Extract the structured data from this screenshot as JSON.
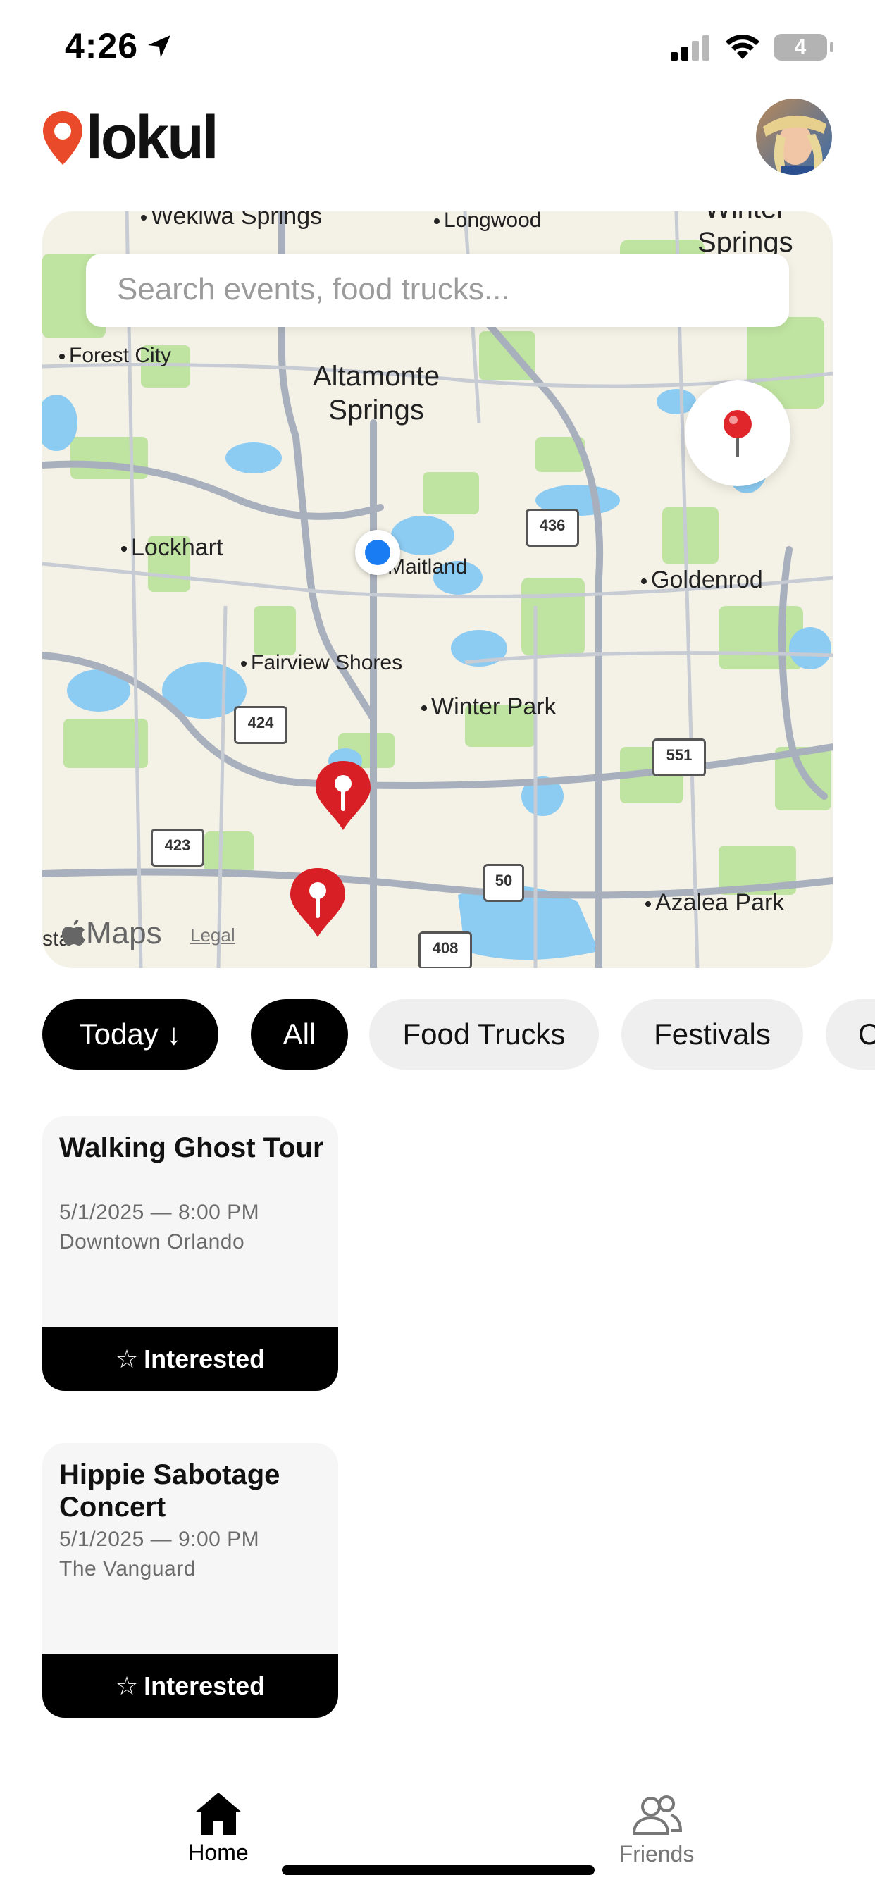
{
  "status_bar": {
    "time": "4:26",
    "battery": "4"
  },
  "header": {
    "logo_text": "lokul",
    "brand_color": "#e84a2a"
  },
  "search": {
    "placeholder": "Search events, food trucks..."
  },
  "map": {
    "labels": {
      "wekiwa": "Wekiwa Springs",
      "longwood": "Longwood",
      "winter_springs_1": "Winter",
      "winter_springs_2": "Springs",
      "forest_city": "Forest City",
      "altamonte_1": "Altamonte",
      "altamonte_2": "Springs",
      "lockhart": "Lockhart",
      "maitland": "Maitland",
      "goldenrod": "Goldenrod",
      "fairview": "Fairview Shores",
      "winter_park": "Winter Park",
      "azalea": "Azalea Park",
      "sta": "sta"
    },
    "shields": {
      "r436": "436",
      "r424": "424",
      "r423": "423",
      "r551": "551",
      "r50": "50",
      "r408": "408"
    },
    "brand": "Maps",
    "legal": "Legal"
  },
  "filters": [
    {
      "label": "Today ↓",
      "selected": true
    },
    {
      "label": "All",
      "selected": true
    },
    {
      "label": "Food Trucks",
      "selected": false
    },
    {
      "label": "Festivals",
      "selected": false
    },
    {
      "label": "C",
      "selected": false
    }
  ],
  "events": [
    {
      "title": "Walking Ghost Tour",
      "datetime": "5/1/2025 — 8:00 PM",
      "venue": "Downtown Orlando",
      "action": "Interested"
    },
    {
      "title": "Hippie Sabotage Concert",
      "datetime": "5/1/2025 — 9:00 PM",
      "venue": "The Vanguard",
      "action": "Interested"
    }
  ],
  "tabbar": {
    "home": "Home",
    "friends": "Friends"
  }
}
